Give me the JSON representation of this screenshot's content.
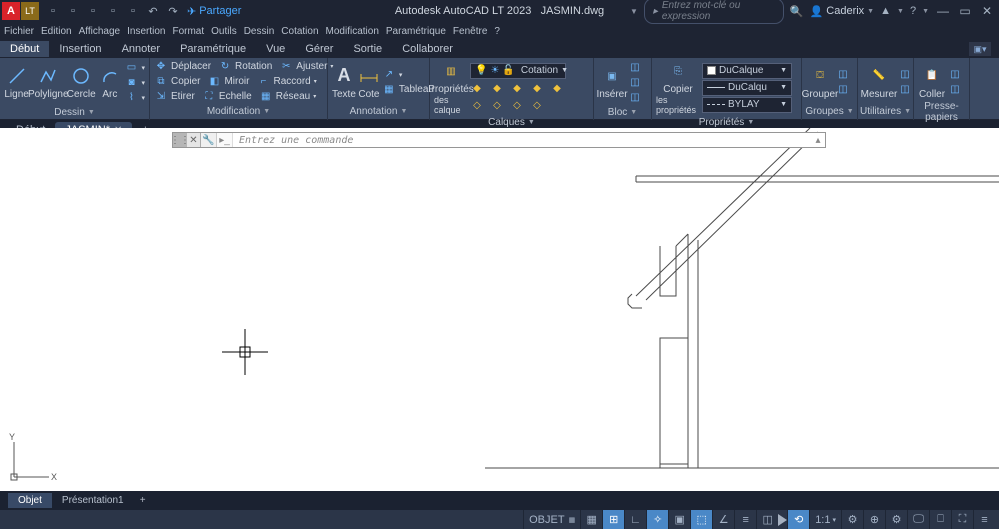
{
  "titlebar": {
    "logo": "A",
    "lt": "LT",
    "share": "Partager",
    "appname": "Autodesk AutoCAD LT 2023",
    "filename": "JASMIN.dwg",
    "search_placeholder": "Entrez mot-clé ou expression",
    "username": "Caderix"
  },
  "menubar": [
    "Fichier",
    "Edition",
    "Affichage",
    "Insertion",
    "Format",
    "Outils",
    "Dessin",
    "Cotation",
    "Modification",
    "Paramétrique",
    "Fenêtre",
    "?"
  ],
  "ribbontabs": [
    "Début",
    "Insertion",
    "Annoter",
    "Paramétrique",
    "Vue",
    "Gérer",
    "Sortie",
    "Collaborer"
  ],
  "ribbon": {
    "dessin": {
      "title": "Dessin",
      "ligne": "Ligne",
      "polyligne": "Polyligne",
      "cercle": "Cercle",
      "arc": "Arc"
    },
    "modification": {
      "title": "Modification",
      "deplacer": "Déplacer",
      "rotation": "Rotation",
      "ajuster": "Ajuster",
      "copier": "Copier",
      "miroir": "Miroir",
      "raccord": "Raccord",
      "etirer": "Etirer",
      "echelle": "Echelle",
      "reseau": "Réseau"
    },
    "annotation": {
      "title": "Annotation",
      "texte": "Texte",
      "cote": "Cote",
      "tableau": "Tableau"
    },
    "calques": {
      "title": "Calques",
      "proprietes": "Propriétés",
      "descalque": "des calque",
      "combo": "Cotation"
    },
    "bloc": {
      "title": "Bloc",
      "inserer": "Insérer"
    },
    "proprietesPanel": {
      "title": "Propriétés",
      "copier": "Copier",
      "les": "les propriétés",
      "layer": "DuCalque",
      "color": "DuCalqu",
      "ltype": "BYLAY"
    },
    "groupes": {
      "title": "Groupes",
      "grouper": "Grouper"
    },
    "utilitaires": {
      "title": "Utilitaires",
      "mesurer": "Mesurer"
    },
    "presse": {
      "title": "Presse-papiers",
      "coller": "Coller"
    }
  },
  "filetabs": {
    "debut": "Début",
    "jasmin": "JASMIN*"
  },
  "cmdline": {
    "placeholder": "Entrez une commande"
  },
  "layouttabs": {
    "objet": "Objet",
    "pres1": "Présentation1"
  },
  "statusbar": {
    "objet": "OBJET",
    "ratio": "1:1"
  },
  "ucs": {
    "x": "X",
    "y": "Y"
  }
}
